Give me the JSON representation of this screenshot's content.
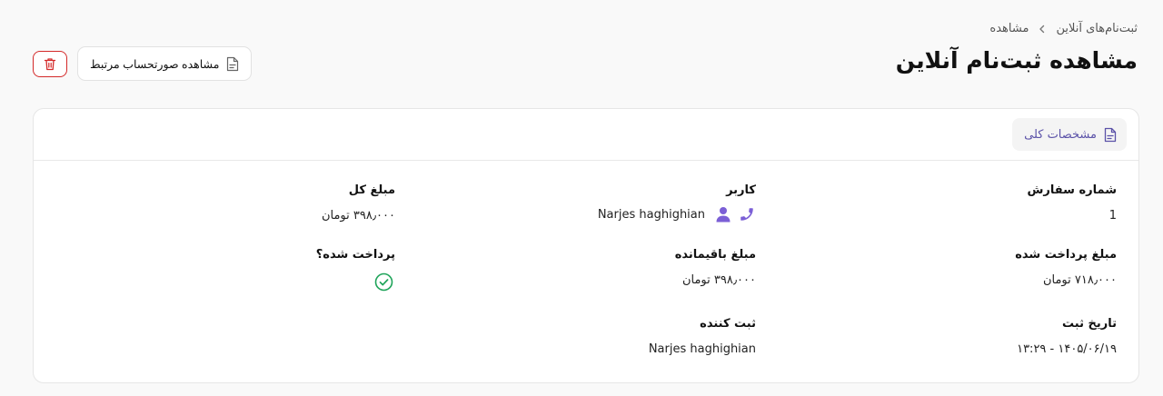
{
  "breadcrumb": {
    "parent": "ثبت‌نام‌های آنلاین",
    "current": "مشاهده"
  },
  "page": {
    "title": "مشاهده ثبت‌نام آنلاین"
  },
  "actions": {
    "view_invoice_label": "مشاهده صورتحساب مرتبط"
  },
  "tabs": {
    "general_label": "مشخصات کلی"
  },
  "details": {
    "order_number": {
      "label": "شماره سفارش",
      "value": "1"
    },
    "user": {
      "label": "کاربر",
      "value": "Narjes haghighian"
    },
    "total_amount": {
      "label": "مبلغ کل",
      "value": "۳۹۸٫۰۰۰ تومان"
    },
    "paid_amount": {
      "label": "مبلغ پرداخت شده",
      "value": "۷۱۸٫۰۰۰ تومان"
    },
    "remaining_amount": {
      "label": "مبلغ باقیمانده",
      "value": "۳۹۸٫۰۰۰ تومان"
    },
    "is_paid": {
      "label": "پرداخت شده؟",
      "value": true
    },
    "registration_date": {
      "label": "تاریخ ثبت",
      "value": "۱۴۰۵/۰۶/۱۹ - ۱۳:۲۹"
    },
    "registered_by": {
      "label": "ثبت کننده",
      "value": "Narjes haghighian"
    }
  },
  "colors": {
    "accent": "#7b5fd6",
    "danger": "#d42a2a",
    "success": "#1fa45a",
    "tab_text": "#5b52a8"
  },
  "icons": {
    "breadcrumb_separator": "chevron-left-icon",
    "invoice": "document-icon",
    "delete": "trash-icon",
    "tab": "document-icon",
    "phone": "phone-icon",
    "user": "user-icon",
    "paid": "check-circle-icon"
  }
}
